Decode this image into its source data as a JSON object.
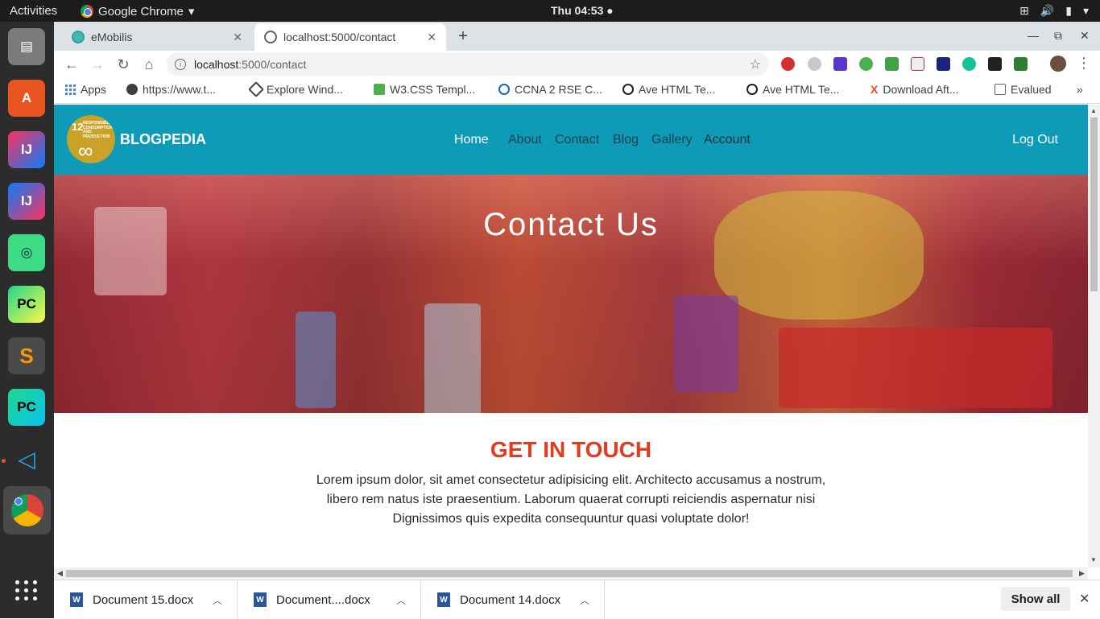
{
  "system": {
    "activities": "Activities",
    "app_name": "Google Chrome",
    "clock": "Thu 04:53"
  },
  "browser": {
    "tabs": [
      {
        "title": "eMobilis",
        "active": false
      },
      {
        "title": "localhost:5000/contact",
        "active": true
      }
    ],
    "url_host": "localhost",
    "url_path": ":5000/contact",
    "bookmarks": [
      "Apps",
      "https://www.t...",
      "Explore Wind...",
      "W3.CSS Templ...",
      "CCNA 2 RSE C...",
      "Ave HTML Te...",
      "Ave HTML Te...",
      "Download Aft...",
      "Evalued"
    ]
  },
  "site": {
    "logo_text": "RESPONSIBLE CONSUMPTION AND PRODUCTION",
    "logo_number": "12",
    "brand": "BLOGPEDIA",
    "nav": [
      "Home",
      "About",
      "Contact",
      "Blog",
      "Gallery",
      "Account"
    ],
    "logout": "Log Out",
    "hero_title": "Contact Us",
    "section_title": "GET IN TOUCH",
    "section_text": "Lorem ipsum dolor, sit amet consectetur adipisicing elit. Architecto accusamus a nostrum, libero rem natus iste praesentium. Laborum quaerat corrupti reiciendis aspernatur nisi Dignissimos quis expedita consequuntur quasi voluptate dolor!",
    "colors": {
      "navbar": "#0e9bb8",
      "accent_title": "#e23b1f",
      "logo": "#c9a227"
    }
  },
  "downloads": {
    "items": [
      "Document 15.docx",
      "Document....docx",
      "Document 14.docx"
    ],
    "show_all": "Show all"
  }
}
